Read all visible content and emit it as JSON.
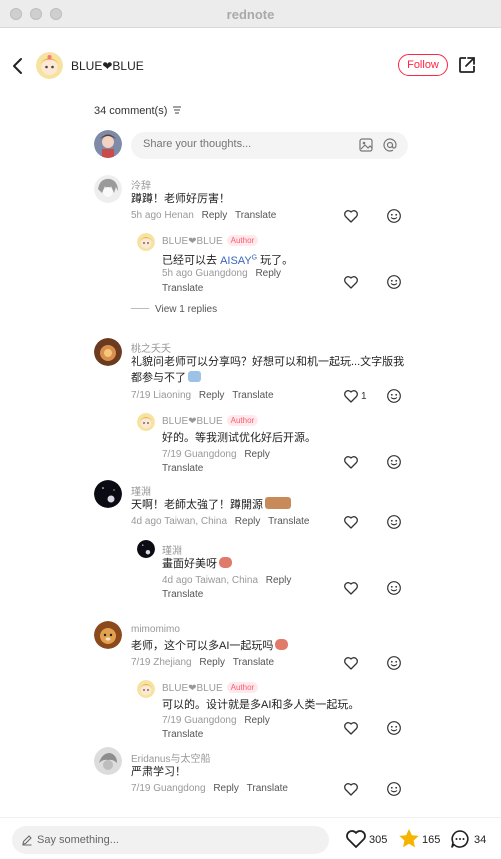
{
  "window": {
    "title": "rednote"
  },
  "header": {
    "author": "BLUE❤BLUE",
    "follow_label": "Follow"
  },
  "comments_count": "34 comment(s)",
  "composer": {
    "placeholder": "Share your thoughts..."
  },
  "labels": {
    "reply": "Reply",
    "translate": "Translate",
    "author_badge": "Author"
  },
  "comments": [
    {
      "user": "泠辞",
      "text": "蹲蹲！老师好厉害！",
      "time": "5h ago",
      "location": "Henan",
      "likes": "",
      "reply": {
        "user": "BLUE❤BLUE",
        "text_before": "已经可以去",
        "link": "AISAY",
        "link_sup": "G",
        "text_after": "玩了。",
        "time": "5h ago",
        "location": "Guangdong"
      },
      "view_replies": "View 1 replies"
    },
    {
      "user": "桃之夭夭",
      "text_line1": "礼貌问老师可以分享吗？好想可以和机一起玩...文字版我",
      "text_line2": "都参与不了",
      "time": "7/19",
      "location": "Liaoning",
      "likes": "1",
      "reply": {
        "user": "BLUE❤BLUE",
        "text": "好的。等我测试优化好后开源。",
        "time": "7/19",
        "location": "Guangdong"
      }
    },
    {
      "user": "瑾淵",
      "text": "天啊！老師太強了！蹲開源",
      "time": "4d ago",
      "location": "Taiwan, China",
      "likes": "",
      "reply": {
        "user": "瑾淵",
        "text": "畫面好美呀",
        "time": "4d ago",
        "location": "Taiwan, China"
      }
    },
    {
      "user": "mimomimo",
      "text": "老师，这个可以多AI一起玩吗",
      "time": "7/19",
      "location": "Zhejiang",
      "likes": "",
      "reply": {
        "user": "BLUE❤BLUE",
        "text": "可以的。设计就是多AI和多人类一起玩。",
        "time": "7/19",
        "location": "Guangdong"
      }
    },
    {
      "user": "Eridanus与太空船",
      "text": "严肃学习！",
      "time": "7/19",
      "location": "Guangdong",
      "likes": ""
    }
  ],
  "bottom": {
    "say_placeholder": "Say something...",
    "likes": "305",
    "stars": "165",
    "comments": "34"
  },
  "colors": {
    "accent": "#ff2442",
    "star": "#f5b400"
  },
  "icons": [
    "back-icon",
    "share-icon",
    "image-icon",
    "at-icon",
    "heart-icon",
    "emoji-icon",
    "pencil-icon",
    "star-icon",
    "chat-icon"
  ]
}
